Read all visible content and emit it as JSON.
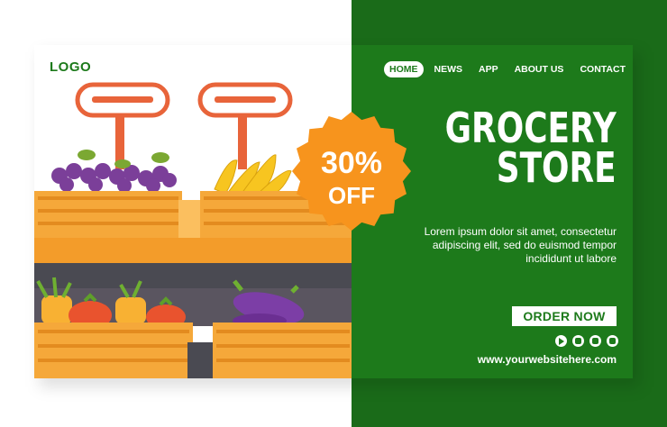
{
  "brand": {
    "logo_text": "LOGO"
  },
  "nav": {
    "items": [
      {
        "label": "HOME",
        "active": true
      },
      {
        "label": "NEWS",
        "active": false
      },
      {
        "label": "APP",
        "active": false
      },
      {
        "label": "ABOUT US",
        "active": false
      },
      {
        "label": "CONTACT",
        "active": false
      }
    ]
  },
  "hero": {
    "title_line1": "GROCERY",
    "title_line2": "STORE",
    "description": "Lorem ipsum dolor sit amet, consectetur adipiscing elit, sed do euismod tempor incididunt ut labore",
    "cta_label": "ORDER NOW",
    "website": "www.yourwebsitehere.com"
  },
  "badge": {
    "percent": "30%",
    "label": "OFF"
  },
  "social": {
    "icons": [
      "youtube-icon",
      "instagram-icon",
      "facebook-icon",
      "twitter-icon"
    ]
  },
  "colors": {
    "green": "#1d7a1b",
    "orange": "#f39c12",
    "crate": "#f5a83a",
    "badge": "#f7941d"
  }
}
